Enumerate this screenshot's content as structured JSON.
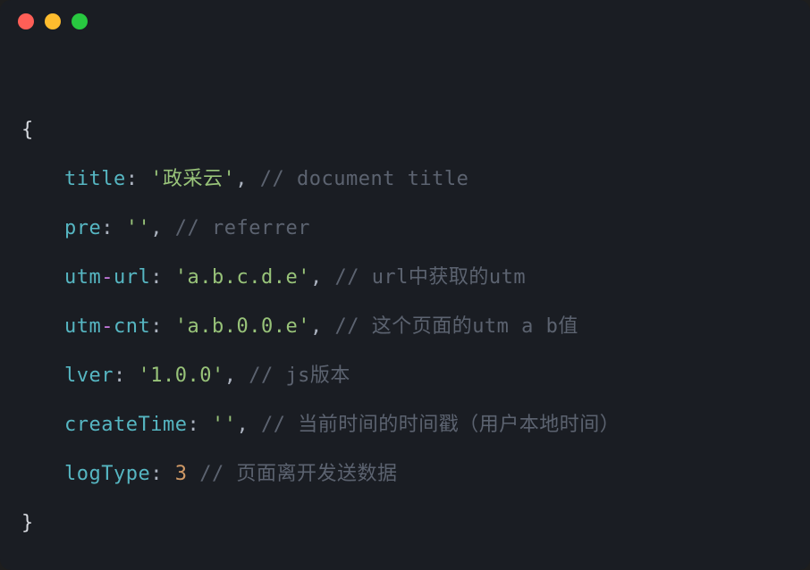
{
  "traffic_lights": {
    "red": "#ff5f57",
    "yellow": "#febc2e",
    "green": "#28c840"
  },
  "code": {
    "open_brace": "{",
    "close_brace": "}",
    "lines": [
      {
        "key": "title",
        "sep": ": ",
        "value": "'政采云'",
        "comma": ", ",
        "comment": "// document title"
      },
      {
        "key": "pre",
        "sep": ": ",
        "value": "''",
        "comma": ", ",
        "comment": "// referrer"
      },
      {
        "key_prefix": "utm",
        "operator": "-",
        "key_suffix": "url",
        "sep": ": ",
        "value": "'a.b.c.d.e'",
        "comma": ", ",
        "comment": "// url中获取的utm"
      },
      {
        "key_prefix": "utm",
        "operator": "-",
        "key_suffix": "cnt",
        "sep": ": ",
        "value": "'a.b.0.0.e'",
        "comma": ", ",
        "comment": "// 这个页面的utm a b值"
      },
      {
        "key": "lver",
        "sep": ": ",
        "value": "'1.0.0'",
        "comma": ", ",
        "comment": "// js版本"
      },
      {
        "key": "createTime",
        "sep": ": ",
        "value": "''",
        "comma": ", ",
        "comment": "// 当前时间的时间戳（用户本地时间）"
      },
      {
        "key": "logType",
        "sep": ": ",
        "number": "3",
        "space": " ",
        "comment": "// 页面离开发送数据"
      }
    ]
  }
}
